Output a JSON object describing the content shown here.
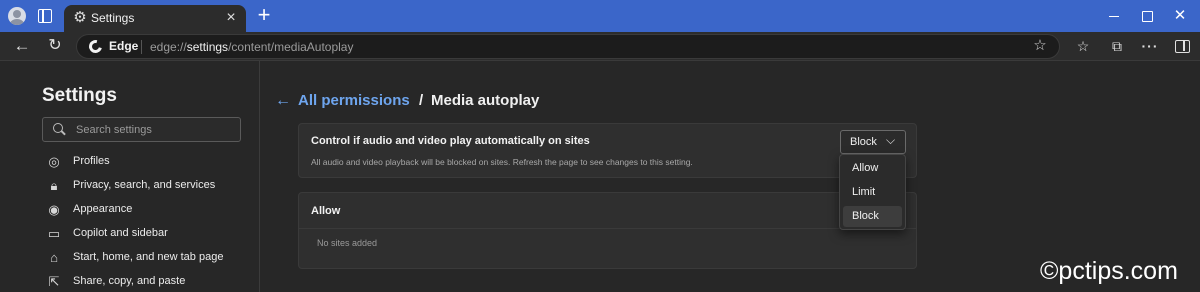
{
  "tab": {
    "title": "Settings",
    "icon": "gear-icon"
  },
  "toolbar": {
    "edge_chip": "Edge",
    "url_prefix": "edge://",
    "url_host": "settings",
    "url_path": "/content/mediaAutoplay"
  },
  "sidebar": {
    "title": "Settings",
    "search_placeholder": "Search settings",
    "items": [
      {
        "label": "Profiles",
        "icon": "profile-icon"
      },
      {
        "label": "Privacy, search, and services",
        "icon": "lock-icon"
      },
      {
        "label": "Appearance",
        "icon": "appearance-icon"
      },
      {
        "label": "Copilot and sidebar",
        "icon": "sidebar-icon"
      },
      {
        "label": "Start, home, and new tab page",
        "icon": "home-icon"
      },
      {
        "label": "Share, copy, and paste",
        "icon": "share-icon"
      }
    ]
  },
  "page": {
    "breadcrumb_link": "All permissions",
    "breadcrumb_sep": "/",
    "breadcrumb_current": "Media autoplay"
  },
  "autoplay_card": {
    "title": "Control if audio and video play automatically on sites",
    "description": "All audio and video playback will be blocked on sites. Refresh the page to see changes to this setting.",
    "selected": "Block",
    "options": [
      "Allow",
      "Limit",
      "Block"
    ]
  },
  "allow_card": {
    "title": "Allow",
    "empty_text": "No sites added"
  },
  "watermark": "©pctips.com"
}
